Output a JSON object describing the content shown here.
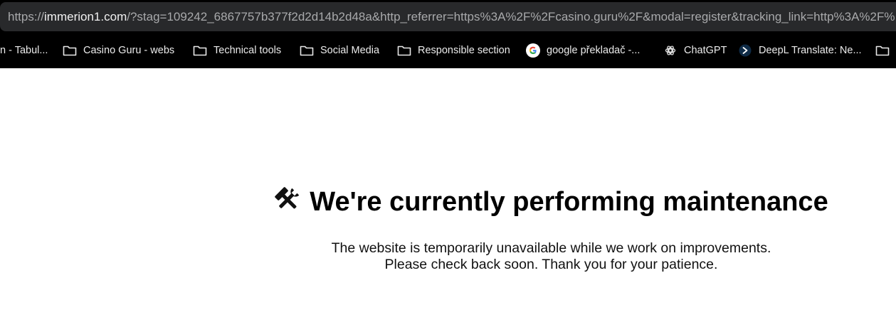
{
  "browser": {
    "url": {
      "scheme": "https://",
      "host": "immerion1.com",
      "rest": "/?stag=109242_6867757b377f2d2d14b2d48a&http_referrer=https%3A%2F%2Fcasino.guru%2F&modal=register&tracking_link=http%3A%2F%"
    },
    "bookmarks": [
      {
        "label": "n - Tabul...",
        "icon": "none"
      },
      {
        "label": "Casino Guru - webs",
        "icon": "folder-icon"
      },
      {
        "label": "Technical tools",
        "icon": "folder-icon"
      },
      {
        "label": "Social Media",
        "icon": "folder-icon"
      },
      {
        "label": "Responsible section",
        "icon": "folder-icon"
      },
      {
        "label": "google překladač -...",
        "icon": "google-icon"
      },
      {
        "label": "ChatGPT",
        "icon": "chatgpt-icon"
      },
      {
        "label": "DeepL Translate: Ne...",
        "icon": "deepl-icon"
      },
      {
        "label": "",
        "icon": "folder-icon"
      }
    ]
  },
  "page": {
    "title": "We're currently performing maintenance",
    "title_icon": "hammer-wrench-icon",
    "message_line1": "The website is temporarily unavailable while we work on improvements.",
    "message_line2": "Please check back soon. Thank you for your patience."
  }
}
